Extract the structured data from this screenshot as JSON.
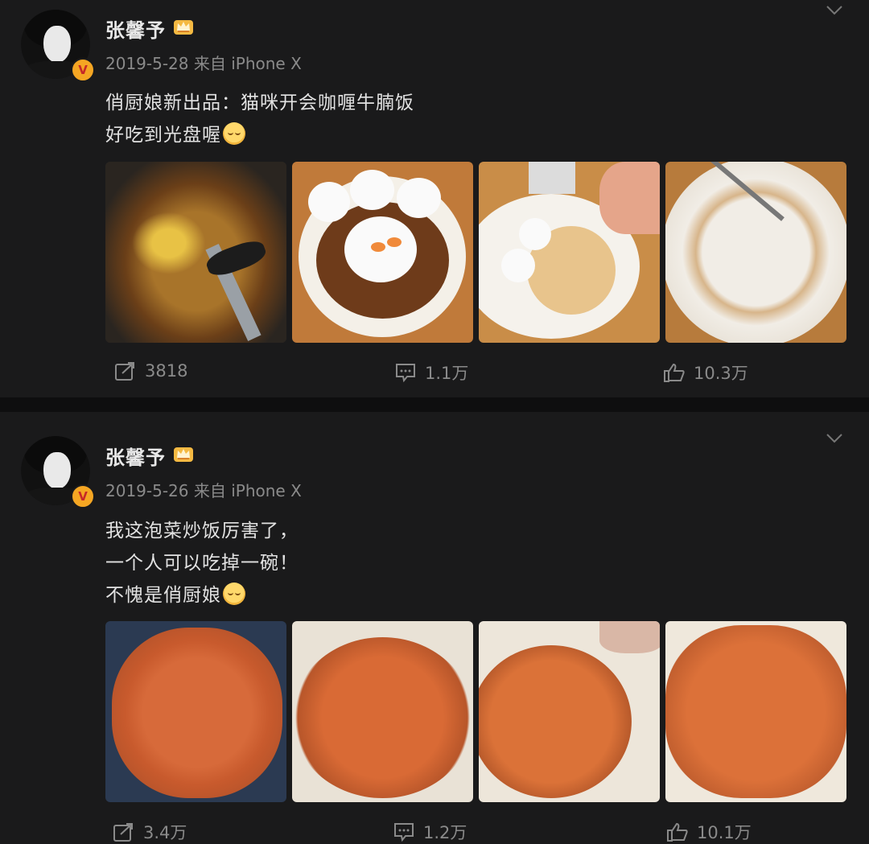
{
  "posts": [
    {
      "author": "张馨予",
      "verified_badge": "V",
      "date": "2019-5-28",
      "source": "来自 iPhone X",
      "text_lines": [
        "俏厨娘新出品：猫咪开会咖喱牛腩饭",
        "好吃到光盘喔"
      ],
      "images": [
        "curry-in-wok-photo",
        "cat-rice-curry-plate-photo",
        "half-eaten-plate-photo",
        "empty-plate-photo"
      ],
      "actions": {
        "share": "3818",
        "comment": "1.1万",
        "like": "10.3万"
      }
    },
    {
      "author": "张馨予",
      "verified_badge": "V",
      "date": "2019-5-26",
      "source": "来自 iPhone X",
      "text_lines": [
        "我这泡菜炒饭厉害了，",
        "一个人可以吃掉一碗！",
        "不愧是俏厨娘"
      ],
      "images": [
        "kimchi-rice-in-pan-photo",
        "kimchi-rice-bowl-photo-1",
        "kimchi-rice-bowl-photo-2",
        "kimchi-rice-bowl-photo-3"
      ],
      "actions": {
        "share": "3.4万",
        "comment": "1.2万",
        "like": "10.1万"
      }
    }
  ],
  "colors": {
    "background": "#1a1a1b",
    "separator": "#0e0e0f",
    "muted": "#8a8a8a",
    "text": "#e2e2e2",
    "badge": "#f5a623"
  },
  "icons": [
    "crown-icon",
    "chevron-down-icon",
    "share-icon",
    "comment-icon",
    "like-icon",
    "smiling-emoji-icon"
  ]
}
